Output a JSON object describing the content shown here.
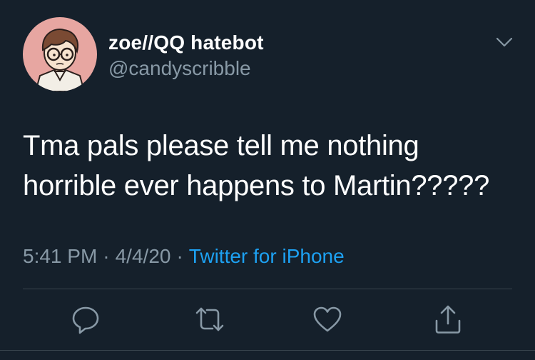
{
  "user": {
    "display_name": "zoe//QQ hatebot",
    "handle": "@candyscribble"
  },
  "tweet": {
    "text_line1": "Tma pals please tell me nothing",
    "text_line2": "horrible ever happens to Martin?????",
    "time": "5:41 PM",
    "separator": "·",
    "date": "4/4/20",
    "source": "Twitter for iPhone"
  },
  "icons": {
    "menu": "chevron-down-icon",
    "reply": "reply-icon",
    "retweet": "retweet-icon",
    "like": "heart-icon",
    "share": "share-icon"
  },
  "colors": {
    "background": "#15202b",
    "text": "#ffffff",
    "secondary": "#8899a6",
    "link": "#1da1f2",
    "avatar_bg": "#e7a6a1"
  }
}
